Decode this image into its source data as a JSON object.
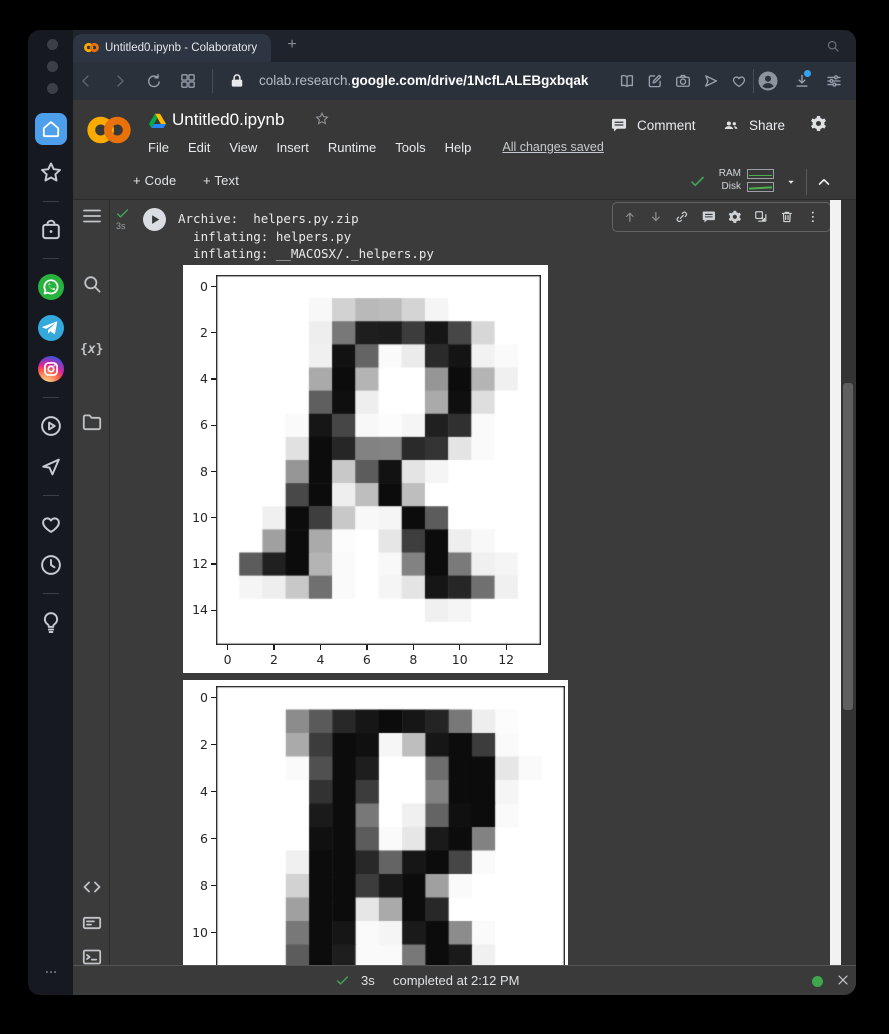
{
  "browser": {
    "tab_title": "Untitled0.ipynb - Colaboratory",
    "new_tab_button": "+",
    "url_prefix": "colab.research.",
    "url_domain": "google.com",
    "url_path": "/drive/1NcfLALEBgxbqak"
  },
  "dock": {
    "items": [
      {
        "name": "home-icon",
        "style": "home",
        "active": true,
        "color": "#4d9fec"
      },
      {
        "name": "favorites-star-icon",
        "style": "star"
      },
      {
        "divider": true
      },
      {
        "name": "shopping-bag-icon",
        "style": "bag"
      },
      {
        "divider": true
      },
      {
        "name": "whatsapp-icon",
        "style": "whatsapp",
        "color": "#29b33e"
      },
      {
        "name": "telegram-icon",
        "style": "telegram",
        "color": "#33a9dc"
      },
      {
        "name": "instagram-icon",
        "style": "instagram"
      },
      {
        "divider": true
      },
      {
        "name": "video-player-icon",
        "style": "playcircle"
      },
      {
        "name": "messenger-send-icon",
        "style": "plane"
      },
      {
        "divider": true
      },
      {
        "name": "likes-heart-icon",
        "style": "heart"
      },
      {
        "name": "history-clock-icon",
        "style": "clock"
      },
      {
        "divider": true
      },
      {
        "name": "ideas-bulb-icon",
        "style": "bulb"
      }
    ]
  },
  "colab": {
    "doc_title": "Untitled0.ipynb",
    "menus": [
      "File",
      "Edit",
      "View",
      "Insert",
      "Runtime",
      "Tools",
      "Help"
    ],
    "save_status": "All changes saved",
    "comment_label": "Comment",
    "share_label": "Share",
    "add_code_label": "+ Code",
    "add_text_label": "+ Text",
    "ram_label": "RAM",
    "disk_label": "Disk",
    "sidebar_top": [
      {
        "name": "table-of-contents-icon",
        "icon": "toc"
      },
      {
        "name": "search-icon",
        "icon": "search"
      },
      {
        "name": "variables-icon",
        "icon": "vars"
      },
      {
        "name": "files-folder-icon",
        "icon": "folder"
      }
    ],
    "sidebar_bottom": [
      {
        "name": "code-snippets-icon",
        "icon": "code"
      },
      {
        "name": "command-palette-icon",
        "icon": "palette"
      },
      {
        "name": "terminal-icon",
        "icon": "terminal"
      }
    ],
    "cell": {
      "exec_badge": "3s",
      "output_text": "Archive:  helpers.py.zip\n  inflating: helpers.py\n  inflating: __MACOSX/._helpers.py",
      "toolbar_icons": [
        {
          "name": "move-cell-up-icon",
          "icon": "arrowup",
          "dim": true
        },
        {
          "name": "move-cell-down-icon",
          "icon": "arrowdown",
          "dim": true
        },
        {
          "name": "copy-link-icon",
          "icon": "link"
        },
        {
          "name": "add-comment-icon",
          "icon": "comment"
        },
        {
          "name": "cell-settings-gear-icon",
          "icon": "gear"
        },
        {
          "name": "mirror-cell-icon",
          "icon": "mirror"
        },
        {
          "name": "delete-cell-icon",
          "icon": "trash"
        },
        {
          "name": "more-cell-actions-icon",
          "icon": "kebab"
        }
      ]
    },
    "status_bar": {
      "duration": "3s",
      "message": "completed at 2:12 PM"
    }
  },
  "colors": {
    "colab_ring_left": "#F9AB00",
    "colab_ring_right": "#E8710A",
    "success_green": "#41a25b",
    "runtime_dot_green": "#3fa64c",
    "whatsapp_green": "#29b33e",
    "telegram_blue": "#33a9dc",
    "home_active_blue": "#4d9fec",
    "download_badge_blue": "#38a1f3"
  },
  "chart_data": [
    {
      "type": "heatmap",
      "title": "",
      "description": "matplotlib imshow of 16x14 grayscale pixel image of handwritten letter R",
      "n_cols": 14,
      "n_rows": 16,
      "x_ticks": [
        0,
        2,
        4,
        6,
        8,
        10,
        12
      ],
      "y_ticks": [
        0,
        2,
        4,
        6,
        8,
        10,
        12,
        14
      ],
      "value_scale": "0=black, 255=white",
      "values": [
        [
          255,
          255,
          255,
          255,
          255,
          255,
          255,
          255,
          255,
          255,
          255,
          255,
          255,
          255
        ],
        [
          255,
          255,
          255,
          255,
          248,
          210,
          185,
          188,
          212,
          245,
          255,
          255,
          255,
          255
        ],
        [
          255,
          255,
          255,
          255,
          238,
          120,
          30,
          28,
          60,
          22,
          70,
          215,
          255,
          255
        ],
        [
          255,
          255,
          255,
          255,
          240,
          18,
          100,
          250,
          235,
          42,
          20,
          242,
          250,
          255
        ],
        [
          255,
          255,
          255,
          255,
          170,
          12,
          180,
          255,
          255,
          150,
          12,
          180,
          240,
          255
        ],
        [
          255,
          255,
          255,
          255,
          95,
          15,
          238,
          255,
          255,
          170,
          15,
          222,
          255,
          255
        ],
        [
          255,
          255,
          255,
          250,
          22,
          70,
          248,
          252,
          245,
          32,
          48,
          250,
          255,
          255
        ],
        [
          255,
          255,
          255,
          225,
          12,
          38,
          130,
          132,
          42,
          52,
          228,
          250,
          255,
          255
        ],
        [
          255,
          255,
          255,
          150,
          12,
          200,
          92,
          18,
          228,
          245,
          255,
          255,
          255,
          255
        ],
        [
          255,
          255,
          255,
          72,
          12,
          238,
          190,
          12,
          190,
          255,
          255,
          255,
          255,
          255
        ],
        [
          255,
          255,
          240,
          12,
          62,
          200,
          248,
          245,
          12,
          92,
          255,
          255,
          255,
          255
        ],
        [
          255,
          255,
          160,
          12,
          170,
          252,
          255,
          230,
          62,
          12,
          238,
          248,
          255,
          255
        ],
        [
          255,
          92,
          32,
          12,
          180,
          250,
          255,
          248,
          130,
          12,
          122,
          240,
          245,
          255
        ],
        [
          255,
          245,
          238,
          200,
          112,
          250,
          255,
          245,
          228,
          22,
          38,
          112,
          240,
          255
        ],
        [
          255,
          255,
          255,
          255,
          255,
          255,
          255,
          255,
          255,
          240,
          245,
          255,
          255,
          255
        ],
        [
          255,
          255,
          255,
          255,
          255,
          255,
          255,
          255,
          255,
          255,
          255,
          255,
          255,
          255
        ]
      ]
    },
    {
      "type": "heatmap",
      "title": "",
      "description": "second matplotlib imshow of grayscale letter R, bottom clipped by viewport",
      "n_cols": 15,
      "n_rows": 12,
      "visible_rows": 12,
      "x_ticks": [],
      "y_ticks": [
        0,
        2,
        4,
        6,
        8,
        10
      ],
      "value_scale": "0=black, 255=white",
      "values": [
        [
          255,
          255,
          255,
          255,
          255,
          255,
          255,
          255,
          255,
          255,
          255,
          255,
          255,
          255,
          255
        ],
        [
          255,
          255,
          255,
          140,
          90,
          40,
          22,
          12,
          22,
          36,
          120,
          238,
          252,
          255,
          255
        ],
        [
          255,
          255,
          255,
          170,
          60,
          12,
          16,
          246,
          190,
          22,
          12,
          60,
          250,
          255,
          255
        ],
        [
          255,
          255,
          255,
          250,
          80,
          12,
          30,
          255,
          255,
          110,
          12,
          12,
          230,
          250,
          255
        ],
        [
          255,
          255,
          255,
          255,
          50,
          12,
          60,
          255,
          255,
          130,
          12,
          12,
          245,
          255,
          255
        ],
        [
          255,
          255,
          255,
          255,
          26,
          12,
          120,
          255,
          240,
          100,
          16,
          12,
          250,
          255,
          255
        ],
        [
          255,
          255,
          255,
          255,
          16,
          12,
          92,
          250,
          230,
          26,
          12,
          130,
          255,
          255,
          255
        ],
        [
          255,
          255,
          255,
          240,
          12,
          12,
          40,
          100,
          22,
          12,
          70,
          250,
          255,
          255,
          255
        ],
        [
          255,
          255,
          255,
          210,
          12,
          12,
          60,
          26,
          12,
          160,
          250,
          255,
          255,
          255,
          255
        ],
        [
          255,
          255,
          255,
          160,
          12,
          12,
          230,
          170,
          12,
          40,
          255,
          255,
          255,
          255,
          255
        ],
        [
          255,
          255,
          255,
          120,
          12,
          22,
          250,
          245,
          26,
          12,
          140,
          250,
          255,
          255,
          255
        ],
        [
          255,
          255,
          255,
          92,
          12,
          30,
          250,
          250,
          120,
          12,
          26,
          240,
          255,
          255,
          255
        ]
      ]
    }
  ]
}
